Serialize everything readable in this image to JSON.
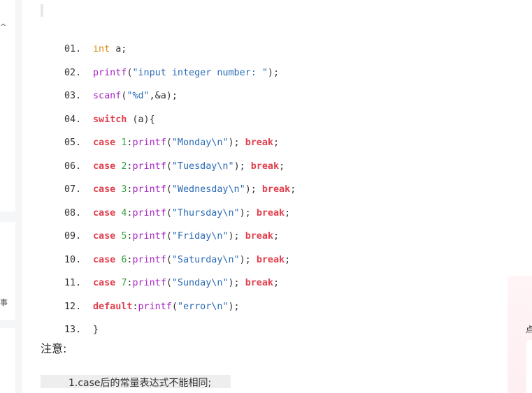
{
  "left_rail": {
    "glyph_top": "^",
    "glyph_mid": "事"
  },
  "code": {
    "lines": [
      {
        "num": "01.",
        "tokens": [
          {
            "t": "int",
            "c": "type"
          },
          {
            "t": " a;",
            "c": "plain"
          }
        ]
      },
      {
        "num": "02.",
        "tokens": [
          {
            "t": "printf",
            "c": "fn"
          },
          {
            "t": "(",
            "c": "punc"
          },
          {
            "t": "\"input integer number: \"",
            "c": "str"
          },
          {
            "t": ");",
            "c": "punc"
          }
        ]
      },
      {
        "num": "03.",
        "tokens": [
          {
            "t": "scanf",
            "c": "fn"
          },
          {
            "t": "(",
            "c": "punc"
          },
          {
            "t": "\"%d\"",
            "c": "str"
          },
          {
            "t": ",&a);",
            "c": "plain"
          }
        ]
      },
      {
        "num": "04.",
        "tokens": [
          {
            "t": "switch",
            "c": "kw"
          },
          {
            "t": " (a){",
            "c": "plain"
          }
        ]
      },
      {
        "num": "05.",
        "tokens": [
          {
            "t": "case",
            "c": "kw"
          },
          {
            "t": " ",
            "c": "plain"
          },
          {
            "t": "1",
            "c": "num"
          },
          {
            "t": ":",
            "c": "punc"
          },
          {
            "t": "printf",
            "c": "fn"
          },
          {
            "t": "(",
            "c": "punc"
          },
          {
            "t": "\"Monday\\n\"",
            "c": "str"
          },
          {
            "t": "); ",
            "c": "punc"
          },
          {
            "t": "break",
            "c": "kw"
          },
          {
            "t": ";",
            "c": "punc"
          }
        ]
      },
      {
        "num": "06.",
        "tokens": [
          {
            "t": "case",
            "c": "kw"
          },
          {
            "t": " ",
            "c": "plain"
          },
          {
            "t": "2",
            "c": "num"
          },
          {
            "t": ":",
            "c": "punc"
          },
          {
            "t": "printf",
            "c": "fn"
          },
          {
            "t": "(",
            "c": "punc"
          },
          {
            "t": "\"Tuesday\\n\"",
            "c": "str"
          },
          {
            "t": "); ",
            "c": "punc"
          },
          {
            "t": "break",
            "c": "kw"
          },
          {
            "t": ";",
            "c": "punc"
          }
        ]
      },
      {
        "num": "07.",
        "tokens": [
          {
            "t": "case",
            "c": "kw"
          },
          {
            "t": " ",
            "c": "plain"
          },
          {
            "t": "3",
            "c": "num"
          },
          {
            "t": ":",
            "c": "punc"
          },
          {
            "t": "printf",
            "c": "fn"
          },
          {
            "t": "(",
            "c": "punc"
          },
          {
            "t": "\"Wednesday\\n\"",
            "c": "str"
          },
          {
            "t": "); ",
            "c": "punc"
          },
          {
            "t": "break",
            "c": "kw"
          },
          {
            "t": ";",
            "c": "punc"
          }
        ]
      },
      {
        "num": "08.",
        "tokens": [
          {
            "t": "case",
            "c": "kw"
          },
          {
            "t": " ",
            "c": "plain"
          },
          {
            "t": "4",
            "c": "num"
          },
          {
            "t": ":",
            "c": "punc"
          },
          {
            "t": "printf",
            "c": "fn"
          },
          {
            "t": "(",
            "c": "punc"
          },
          {
            "t": "\"Thursday\\n\"",
            "c": "str"
          },
          {
            "t": "); ",
            "c": "punc"
          },
          {
            "t": "break",
            "c": "kw"
          },
          {
            "t": ";",
            "c": "punc"
          }
        ]
      },
      {
        "num": "09.",
        "tokens": [
          {
            "t": "case",
            "c": "kw"
          },
          {
            "t": " ",
            "c": "plain"
          },
          {
            "t": "5",
            "c": "num"
          },
          {
            "t": ":",
            "c": "punc"
          },
          {
            "t": "printf",
            "c": "fn"
          },
          {
            "t": "(",
            "c": "punc"
          },
          {
            "t": "\"Friday\\n\"",
            "c": "str"
          },
          {
            "t": "); ",
            "c": "punc"
          },
          {
            "t": "break",
            "c": "kw"
          },
          {
            "t": ";",
            "c": "punc"
          }
        ]
      },
      {
        "num": "10.",
        "tokens": [
          {
            "t": "case",
            "c": "kw"
          },
          {
            "t": " ",
            "c": "plain"
          },
          {
            "t": "6",
            "c": "num"
          },
          {
            "t": ":",
            "c": "punc"
          },
          {
            "t": "printf",
            "c": "fn"
          },
          {
            "t": "(",
            "c": "punc"
          },
          {
            "t": "\"Saturday\\n\"",
            "c": "str"
          },
          {
            "t": "); ",
            "c": "punc"
          },
          {
            "t": "break",
            "c": "kw"
          },
          {
            "t": ";",
            "c": "punc"
          }
        ]
      },
      {
        "num": "11.",
        "tokens": [
          {
            "t": "case",
            "c": "kw"
          },
          {
            "t": " ",
            "c": "plain"
          },
          {
            "t": "7",
            "c": "num"
          },
          {
            "t": ":",
            "c": "punc"
          },
          {
            "t": "printf",
            "c": "fn"
          },
          {
            "t": "(",
            "c": "punc"
          },
          {
            "t": "\"Sunday\\n\"",
            "c": "str"
          },
          {
            "t": "); ",
            "c": "punc"
          },
          {
            "t": "break",
            "c": "kw"
          },
          {
            "t": ";",
            "c": "punc"
          }
        ]
      },
      {
        "num": "12.",
        "tokens": [
          {
            "t": "default",
            "c": "kw"
          },
          {
            "t": ":",
            "c": "punc"
          },
          {
            "t": "printf",
            "c": "fn"
          },
          {
            "t": "(",
            "c": "punc"
          },
          {
            "t": "\"error\\n\"",
            "c": "str"
          },
          {
            "t": ");",
            "c": "punc"
          }
        ]
      },
      {
        "num": "13.",
        "tokens": [
          {
            "t": "}",
            "c": "plain"
          }
        ]
      }
    ]
  },
  "notes": {
    "title": "注意:",
    "items": [
      "1.case后的常量表达式不能相同;"
    ]
  },
  "float_card": {
    "label": "点"
  },
  "colors": {
    "keyword": "#e0404e",
    "function": "#a626c4",
    "string": "#2a6bb5",
    "number": "#3ba140",
    "type": "#d88a14"
  }
}
